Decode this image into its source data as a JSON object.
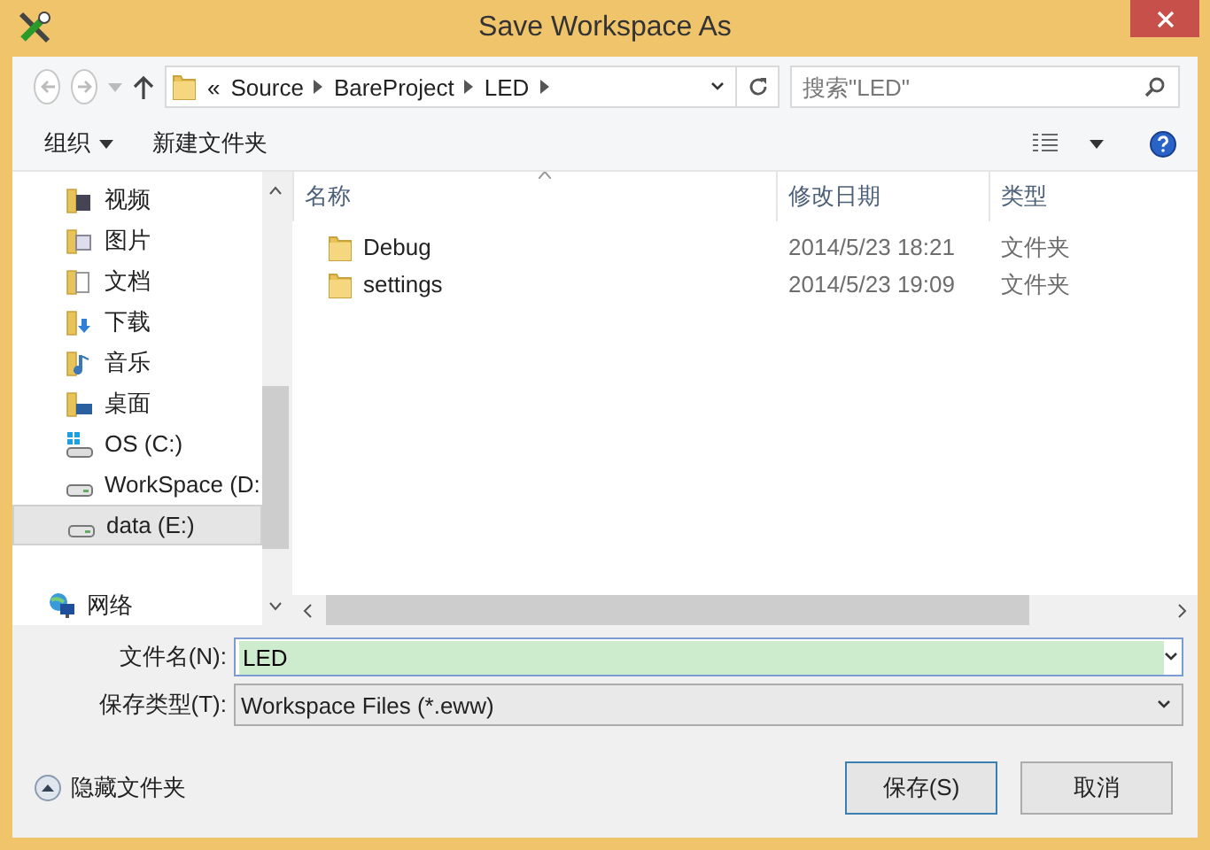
{
  "window": {
    "title": "Save Workspace As"
  },
  "nav": {
    "overflow": "«",
    "breadcrumb": [
      "Source",
      "BareProject",
      "LED"
    ],
    "search_placeholder": "搜索\"LED\""
  },
  "toolbar": {
    "organize": "组织",
    "new_folder": "新建文件夹"
  },
  "sidebar": {
    "items": [
      {
        "label": "视频",
        "kind": "video",
        "selected": false
      },
      {
        "label": "图片",
        "kind": "pictures",
        "selected": false
      },
      {
        "label": "文档",
        "kind": "documents",
        "selected": false
      },
      {
        "label": "下载",
        "kind": "downloads",
        "selected": false
      },
      {
        "label": "音乐",
        "kind": "music",
        "selected": false
      },
      {
        "label": "桌面",
        "kind": "desktop",
        "selected": false
      },
      {
        "label": "OS (C:)",
        "kind": "system_drive",
        "selected": false
      },
      {
        "label": "WorkSpace (D:",
        "kind": "drive",
        "selected": false
      },
      {
        "label": "data (E:)",
        "kind": "drive",
        "selected": true
      },
      {
        "label": "网络",
        "kind": "network",
        "selected": false
      }
    ]
  },
  "table": {
    "columns": [
      "名称",
      "修改日期",
      "类型"
    ],
    "rows": [
      {
        "name": "Debug",
        "modified": "2014/5/23 18:21",
        "type": "文件夹"
      },
      {
        "name": "settings",
        "modified": "2014/5/23 19:09",
        "type": "文件夹"
      }
    ]
  },
  "form": {
    "file_name": {
      "label": "文件名(N):",
      "value": "LED"
    },
    "file_type": {
      "label": "保存类型(T):",
      "value": "Workspace Files (*.eww)"
    }
  },
  "hide_folders": "隐藏文件夹",
  "buttons": [
    {
      "label": "保存(S)",
      "default": true
    },
    {
      "label": "取消",
      "default": false
    }
  ]
}
